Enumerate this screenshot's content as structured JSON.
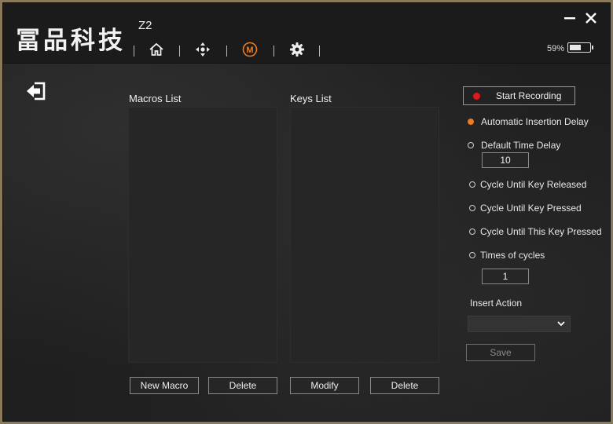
{
  "header": {
    "logo_text": "冨品科技",
    "model": "Z2",
    "nav_icons": [
      "home-icon",
      "dpad-icon",
      "macro-icon",
      "gear-icon"
    ],
    "active_nav": "macro-icon",
    "battery_percent": "59%",
    "battery_level": 0.59
  },
  "macros": {
    "label": "Macros List",
    "items": [],
    "new_button": "New Macro",
    "delete_button": "Delete"
  },
  "keys": {
    "label": "Keys List",
    "items": [],
    "modify_button": "Modify",
    "delete_button": "Delete"
  },
  "recording": {
    "start_button": "Start Recording"
  },
  "options": {
    "auto_delay": "Automatic Insertion Delay",
    "default_delay": "Default Time Delay",
    "default_delay_value": "10",
    "cycle_released": "Cycle Until Key Released",
    "cycle_pressed": "Cycle Until Key Pressed",
    "cycle_this_key": "Cycle Until This Key Pressed",
    "times_cycles": "Times of cycles",
    "times_cycles_value": "1",
    "selected": "auto_delay"
  },
  "insert_action": {
    "label": "Insert Action",
    "value": ""
  },
  "save_button": "Save",
  "colors": {
    "accent": "#ee7b1f",
    "record": "#e3161b"
  }
}
